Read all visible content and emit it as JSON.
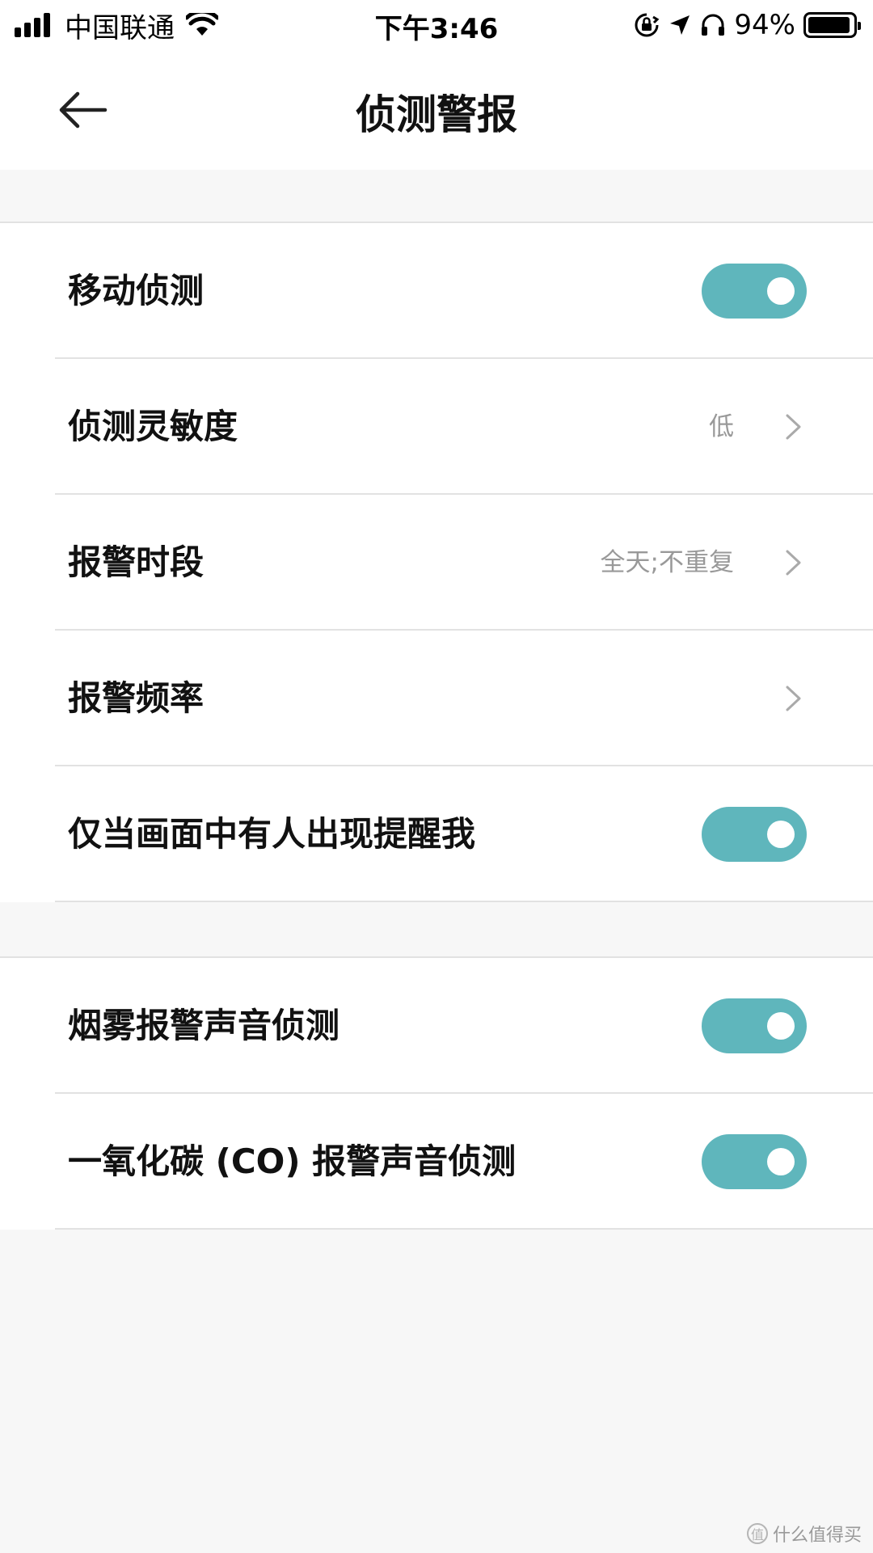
{
  "status_bar": {
    "carrier": "中国联通",
    "time": "下午3:46",
    "battery_percent": "94%",
    "battery_level": 0.94,
    "icons": [
      "signal-icon",
      "wifi-icon",
      "orientation-lock-icon",
      "location-icon",
      "headphones-icon",
      "battery-icon"
    ]
  },
  "header": {
    "title": "侦测警报",
    "back_icon": "arrow-left-icon"
  },
  "settings": {
    "group1": [
      {
        "label": "移动侦测",
        "type": "toggle",
        "on": true
      },
      {
        "label": "侦测灵敏度",
        "type": "link",
        "value": "低"
      },
      {
        "label": "报警时段",
        "type": "link",
        "value": "全天;不重复"
      },
      {
        "label": "报警频率",
        "type": "link",
        "value": ""
      },
      {
        "label": "仅当画面中有人出现提醒我",
        "type": "toggle",
        "on": true
      }
    ],
    "group2": [
      {
        "label": "烟雾报警声音侦测",
        "type": "toggle",
        "on": true
      },
      {
        "label": "一氧化碳 (CO) 报警声音侦测",
        "type": "toggle",
        "on": true
      }
    ]
  },
  "colors": {
    "toggle_on": "#5fb6bc",
    "background": "#f7f7f7",
    "separator": "#e2e2e2"
  },
  "watermark": {
    "badge": "值",
    "text": "什么值得买"
  }
}
